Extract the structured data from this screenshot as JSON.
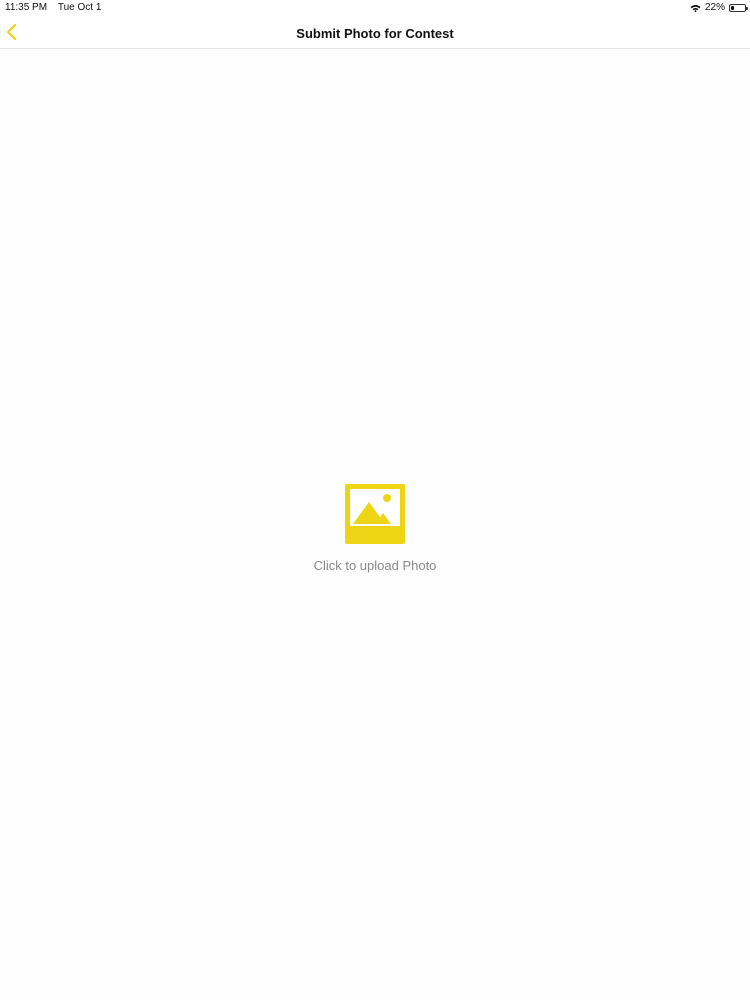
{
  "status_bar": {
    "time": "11:35 PM",
    "date": "Tue Oct 1",
    "battery_percent": "22%",
    "battery_level": 0.22,
    "wifi_icon": "wifi-icon",
    "battery_icon": "battery-icon"
  },
  "nav": {
    "title": "Submit Photo for Contest",
    "back_icon": "chevron-left-icon"
  },
  "upload": {
    "icon": "photo-icon",
    "label": "Click to upload Photo"
  },
  "colors": {
    "accent": "#edd414",
    "upload_label": "#8a8a8e"
  }
}
